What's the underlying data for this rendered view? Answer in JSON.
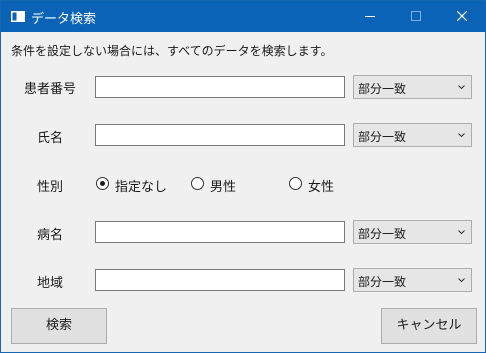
{
  "window": {
    "title": "データ検索"
  },
  "description": "条件を設定しない場合には、すべてのデータを検索します。",
  "fields": {
    "patient_number": {
      "label": "患者番号",
      "value": "",
      "match": "部分一致"
    },
    "name": {
      "label": "氏名",
      "value": "",
      "match": "部分一致"
    },
    "gender": {
      "label": "性別",
      "options": [
        "指定なし",
        "男性",
        "女性"
      ],
      "selected": "指定なし"
    },
    "disease": {
      "label": "病名",
      "value": "",
      "match": "部分一致"
    },
    "region": {
      "label": "地域",
      "value": "",
      "match": "部分一致"
    }
  },
  "buttons": {
    "search": "検索",
    "cancel": "キャンセル"
  },
  "icons": {
    "app": "window-app-icon",
    "minimize": "minimize-icon",
    "maximize": "maximize-icon",
    "close": "close-icon",
    "dropdown": "chevron-down-icon"
  },
  "colors": {
    "titlebar": "#0b63b7",
    "window_bg": "#f0f0f0"
  }
}
